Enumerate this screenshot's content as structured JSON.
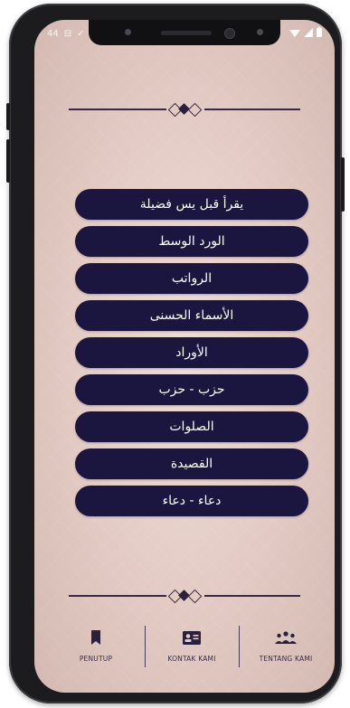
{
  "status_bar": {
    "left_glyphs": [
      "44",
      "⊟",
      "✓",
      "○"
    ],
    "right_icons": [
      "wifi-icon",
      "signal-icon",
      "battery-icon"
    ]
  },
  "menu": {
    "items": [
      {
        "label": "يقرأ قبل يس فضيلة"
      },
      {
        "label": "الورد الوسط"
      },
      {
        "label": "الرواتب"
      },
      {
        "label": "الأسماء الحسنى"
      },
      {
        "label": "الأوراد"
      },
      {
        "label": "حزب - حزب"
      },
      {
        "label": "الصلوات"
      },
      {
        "label": "القصيدة"
      },
      {
        "label": "دعاء - دعاء"
      }
    ]
  },
  "bottom_nav": {
    "items": [
      {
        "label": "PENUTUP",
        "icon": "bookmark-icon"
      },
      {
        "label": "KONTAK KAMI",
        "icon": "contact-card-icon"
      },
      {
        "label": "TENTANG KAMI",
        "icon": "group-icon"
      }
    ]
  },
  "colors": {
    "button_bg": "#1b1640",
    "button_text": "#ffffff",
    "ornament": "#3a2848",
    "background": "#e6cfc8",
    "nav_icon": "#2a1f3d"
  }
}
